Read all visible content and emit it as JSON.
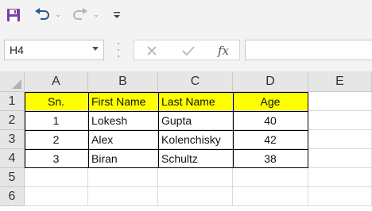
{
  "toolbar": {
    "icons": [
      "save-icon",
      "undo-icon",
      "redo-icon",
      "customize-icon"
    ],
    "colors": {
      "save": "#7a3ea8",
      "undo": "#2b579a",
      "redo": "#b5b5b5"
    }
  },
  "formula_bar": {
    "name_box": "H4",
    "formula": "",
    "fx_label": "fx"
  },
  "sheet": {
    "columns": [
      "A",
      "B",
      "C",
      "D",
      "E"
    ],
    "rows": [
      "1",
      "2",
      "3",
      "4",
      "5",
      "6"
    ],
    "header_fill": "#ffff00",
    "table": {
      "headers": [
        "Sn.",
        "First Name",
        "Last Name",
        "Age"
      ],
      "rows": [
        [
          "1",
          "Lokesh",
          "Gupta",
          "40"
        ],
        [
          "2",
          "Alex",
          "Kolenchisky",
          "42"
        ],
        [
          "3",
          "Biran",
          "Schultz",
          "38"
        ]
      ]
    }
  }
}
